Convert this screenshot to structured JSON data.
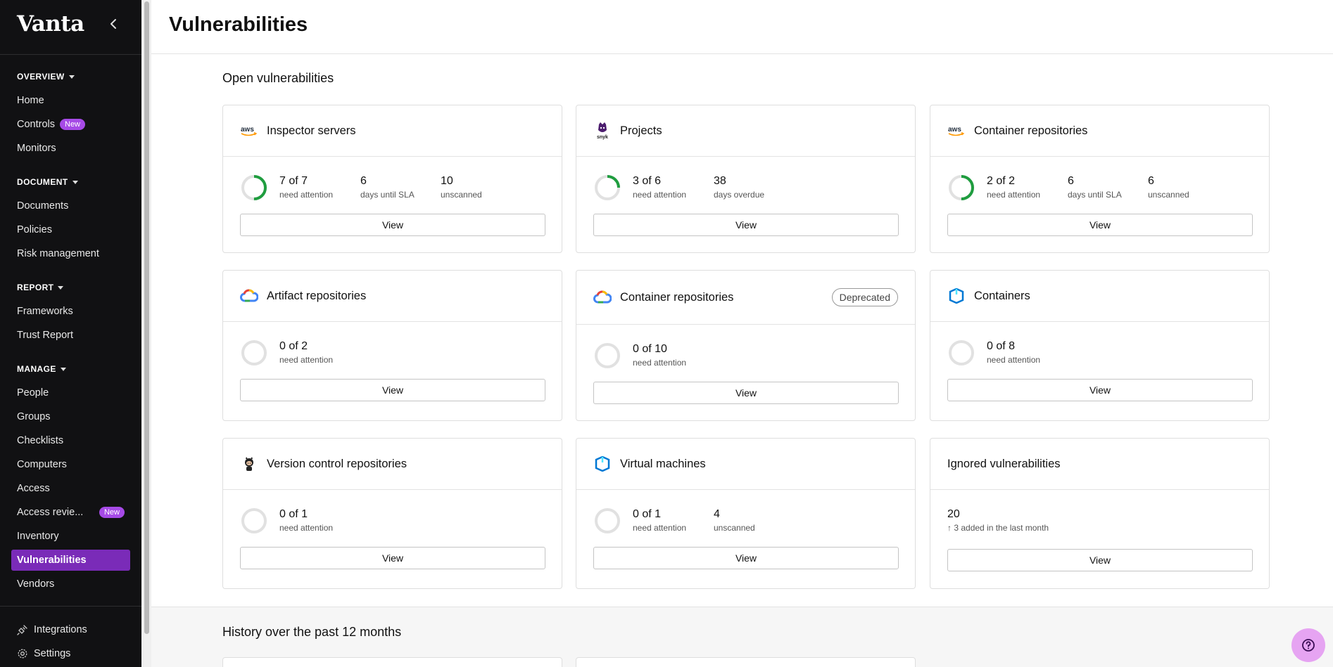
{
  "sidebar": {
    "logo": "Vanta",
    "sections": [
      {
        "label": "OVERVIEW",
        "items": [
          {
            "label": "Home"
          },
          {
            "label": "Controls",
            "badge": "New"
          },
          {
            "label": "Monitors"
          }
        ]
      },
      {
        "label": "DOCUMENT",
        "items": [
          {
            "label": "Documents"
          },
          {
            "label": "Policies"
          },
          {
            "label": "Risk management"
          }
        ]
      },
      {
        "label": "REPORT",
        "items": [
          {
            "label": "Frameworks"
          },
          {
            "label": "Trust Report"
          }
        ]
      },
      {
        "label": "MANAGE",
        "items": [
          {
            "label": "People"
          },
          {
            "label": "Groups"
          },
          {
            "label": "Checklists"
          },
          {
            "label": "Computers"
          },
          {
            "label": "Access"
          },
          {
            "label": "Access revie...",
            "badge": "New"
          },
          {
            "label": "Inventory"
          },
          {
            "label": "Vulnerabilities",
            "active": true
          },
          {
            "label": "Vendors"
          }
        ]
      }
    ],
    "footer": [
      {
        "label": "Integrations",
        "icon": "plug-icon"
      },
      {
        "label": "Settings",
        "icon": "gear-icon"
      }
    ]
  },
  "page": {
    "title": "Vulnerabilities",
    "open_section_title": "Open vulnerabilities",
    "history_section_title": "History over the past 12 months",
    "view_label": "View"
  },
  "cards": [
    {
      "title": "Inspector servers",
      "icon": "aws-icon",
      "attention": "7 of 7",
      "attention_label": "need attention",
      "progress": 1.0,
      "stats": [
        {
          "value": "6",
          "label": "days until SLA"
        },
        {
          "value": "10",
          "label": "unscanned"
        }
      ]
    },
    {
      "title": "Projects",
      "icon": "snyk-icon",
      "attention": "3 of 6",
      "attention_label": "need attention",
      "progress": 0.5,
      "stats": [
        {
          "value": "38",
          "label": "days overdue"
        }
      ]
    },
    {
      "title": "Container repositories",
      "icon": "aws-icon",
      "attention": "2 of 2",
      "attention_label": "need attention",
      "progress": 1.0,
      "stats": [
        {
          "value": "6",
          "label": "days until SLA"
        },
        {
          "value": "6",
          "label": "unscanned"
        }
      ]
    },
    {
      "title": "Artifact repositories",
      "icon": "gcp-icon",
      "attention": "0 of 2",
      "attention_label": "need attention",
      "progress": 0,
      "stats": []
    },
    {
      "title": "Container repositories",
      "icon": "gcp-icon",
      "badge": "Deprecated",
      "attention": "0 of 10",
      "attention_label": "need attention",
      "progress": 0,
      "stats": []
    },
    {
      "title": "Containers",
      "icon": "azure-icon",
      "attention": "0 of 8",
      "attention_label": "need attention",
      "progress": 0,
      "stats": []
    },
    {
      "title": "Version control repositories",
      "icon": "github-icon",
      "attention": "0 of 1",
      "attention_label": "need attention",
      "progress": 0,
      "stats": []
    },
    {
      "title": "Virtual machines",
      "icon": "azure-icon",
      "attention": "0 of 1",
      "attention_label": "need attention",
      "progress": 0,
      "stats": [
        {
          "value": "4",
          "label": "unscanned"
        }
      ]
    }
  ],
  "ignored": {
    "title": "Ignored vulnerabilities",
    "count": "20",
    "note": "↑ 3 added in the last month"
  },
  "colors": {
    "accent": "#7a2bb8",
    "ring_fill": "#1f9d3f",
    "ring_track": "#e1e1e1",
    "help": "#e6a4f2"
  }
}
